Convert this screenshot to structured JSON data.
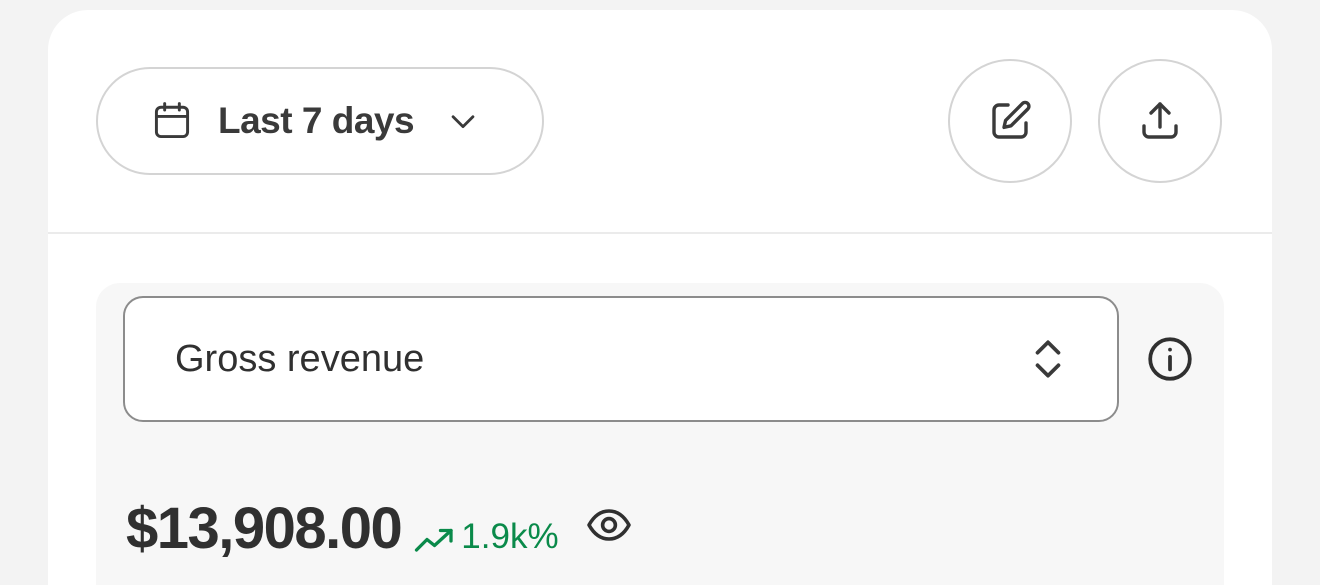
{
  "toolbar": {
    "date_range_label": "Last 7 days",
    "date_icon": "calendar-icon",
    "dropdown_icon": "chevron-down-icon",
    "edit_icon": "edit-icon",
    "export_icon": "upload-icon"
  },
  "metric": {
    "selected": "Gross revenue",
    "selector_icon": "chevron-up-down-icon",
    "info_icon": "info-icon",
    "value": "$13,908.00",
    "change": "1.9k%",
    "change_icon": "trend-up-icon",
    "visibility_icon": "eye-icon"
  },
  "colors": {
    "positive": "#0a8a4a",
    "text": "#303030",
    "border": "#d4d4d4"
  }
}
